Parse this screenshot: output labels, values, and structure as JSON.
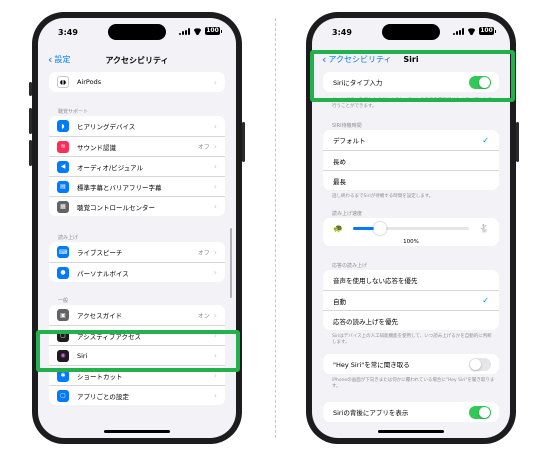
{
  "left": {
    "time": "3:49",
    "battery": "100",
    "back_label": "設定",
    "title": "アクセシビリティ",
    "airpods": {
      "label": "AirPods"
    },
    "hearing_header": "聴覚サポート",
    "hearing_items": [
      {
        "label": "ヒアリングデバイス",
        "value": "",
        "icon": "ear-icon",
        "color": "#007aff"
      },
      {
        "label": "サウンド認識",
        "value": "オフ",
        "icon": "waveform-icon",
        "color": "#ff2d55"
      },
      {
        "label": "オーディオ/ビジュアル",
        "value": "",
        "icon": "speaker-icon",
        "color": "#007aff"
      },
      {
        "label": "標準字幕とバリアフリー字幕",
        "value": "",
        "icon": "captions-icon",
        "color": "#007aff"
      },
      {
        "label": "聴覚コントロールセンター",
        "value": "",
        "icon": "control-center-icon",
        "color": "#636366"
      }
    ],
    "speech_header": "読み上げ",
    "speech_items": [
      {
        "label": "ライブスピーチ",
        "value": "オフ",
        "icon": "keyboard-icon",
        "color": "#007aff"
      },
      {
        "label": "パーソナルボイス",
        "value": "",
        "icon": "person-voice-icon",
        "color": "#007aff"
      }
    ],
    "general_header": "一般",
    "general_items": [
      {
        "label": "アクセスガイド",
        "value": "オン",
        "icon": "lock-icon",
        "color": "#636366"
      },
      {
        "label": "アシスティブアクセス",
        "value": "",
        "icon": "assistive-icon",
        "color": "#1c1c1e"
      },
      {
        "label": "Siri",
        "value": "",
        "icon": "siri-icon",
        "color": "#1c1c1e"
      },
      {
        "label": "ショートカット",
        "value": "",
        "icon": "shortcut-icon",
        "color": "#007aff"
      },
      {
        "label": "アプリごとの設定",
        "value": "",
        "icon": "app-settings-icon",
        "color": "#007aff"
      }
    ],
    "highlight_color": "#22b14c"
  },
  "right": {
    "time": "3:49",
    "battery": "100",
    "back_label": "アクセシビリティ",
    "title": "Siri",
    "type_to_siri": {
      "label": "Siriにタイプ入力",
      "on": true
    },
    "type_to_siri_footer": "サイドボタンを押したままにすると、Siriへの指示を音声ではなくタイプ入力で行うことができます。",
    "pause_header": "SIRI待機時間",
    "pause_options": [
      {
        "label": "デフォルト",
        "checked": true
      },
      {
        "label": "長め",
        "checked": false
      },
      {
        "label": "最長",
        "checked": false
      }
    ],
    "pause_footer": "話し終わるまでSiriが待機する時間を設定します。",
    "rate_header": "読み上げ速度",
    "rate_value": "100%",
    "rate_fraction": 0.23,
    "responses_header": "応答の読み上げ",
    "response_options": [
      {
        "label": "音声を使用しない応答を優先",
        "checked": false
      },
      {
        "label": "自動",
        "checked": true
      },
      {
        "label": "応答の読み上げを優先",
        "checked": false
      }
    ],
    "responses_footer": "Siriはデバイス上の人工知能機能を使用して、いつ読み上げるかを自動的に判断します。",
    "hey_siri": {
      "label": "\"Hey Siri\"を常に聞き取る",
      "on": false
    },
    "hey_siri_footer": "iPhoneの画面が下向きまたは何かに覆われている場合に\"Hey Siri\"を聞き取ります。",
    "show_apps": {
      "label": "Siriの背後にアプリを表示",
      "on": true
    },
    "highlight_color": "#22b14c"
  }
}
